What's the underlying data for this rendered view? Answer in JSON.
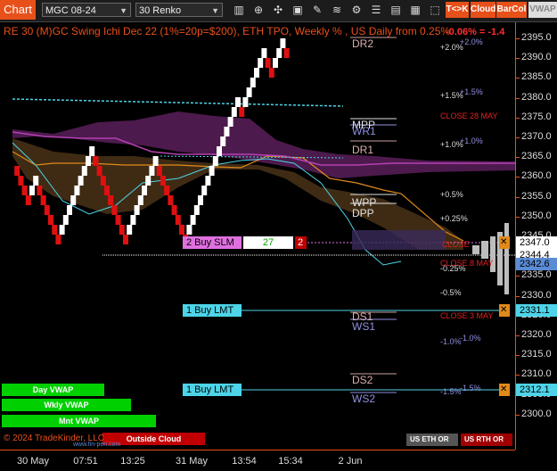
{
  "toolbar": {
    "chart_label": "Chart",
    "instrument": "MGC 08-24",
    "bar_type": "30 Renko",
    "tk_label": "T<>K",
    "cloud_label": "Cloud",
    "barcol_label": "BarCol",
    "vwap_label": "VWAP"
  },
  "header": {
    "title": "RE 30 (M)GC Swing Ichi Dec 22 (1%=20p=$200), ETH TPO, Weekly % , US Daily from 0.25%",
    "change": "-0.06% = -1.4"
  },
  "price_axis": {
    "labels": [
      "2395.0",
      "2390.0",
      "2385.0",
      "2380.0",
      "2375.0",
      "2370.0",
      "2365.0",
      "2360.0",
      "2355.0",
      "2350.0",
      "2345.0",
      "2340.0",
      "2335.0",
      "2330.0",
      "2325.0",
      "2320.0",
      "2315.0",
      "2310.0",
      "2305.0",
      "2300.0"
    ],
    "badges": [
      {
        "text": "2347.0",
        "bg": "#ffffff",
        "fg": "#000000"
      },
      {
        "text": "2344.4",
        "bg": "#ffffff",
        "fg": "#000000"
      },
      {
        "text": "2342.6",
        "bg": "#5a8cd6",
        "fg": "#000000"
      },
      {
        "text": "2331.1",
        "bg": "#4dd4e8",
        "fg": "#000000"
      },
      {
        "text": "2312.1",
        "bg": "#4dd4e8",
        "fg": "#000000"
      }
    ]
  },
  "time_axis": {
    "labels": [
      "30 May",
      "07:51",
      "13:25",
      "31 May",
      "13:54",
      "15:34",
      "2 Jun"
    ]
  },
  "levels": {
    "dr2": "DR2",
    "mpp": "MPP",
    "wr1": "WR1",
    "dr1": "DR1",
    "wpp": "WPP",
    "dpp": "DPP",
    "ds1": "DS1",
    "ws1": "WS1",
    "ds2": "DS2",
    "ws2": "WS2"
  },
  "pct_left": {
    "p20": "+2.0%",
    "p15": "+1.5%",
    "p10": "+1.0%",
    "p05": "+0.5%",
    "p025": "+0.25%",
    "m025": "-0.25%",
    "m05": "-0.5%",
    "m10": "-1.0%",
    "m15": "-1.5%"
  },
  "pct_right": {
    "p20": "+2.0%",
    "p15": "+1.5%",
    "p10": "+1.0%",
    "m10": "-1.0%",
    "m15": "-1.5%"
  },
  "closes": {
    "c28": "CLOSE 28 MAY",
    "c3": "CLOSE 3 MAY",
    "close_a": "CLOSE",
    "close_b": "CLOSE 8 MAY"
  },
  "orders": {
    "buy_slm": "2 Buy SLM",
    "slm_qty": "27",
    "slm_cnt": "2",
    "buy_lmt1": "1 Buy LMT",
    "buy_lmt2": "1 Buy LMT"
  },
  "vwap_bars": {
    "day": "Day VWAP",
    "wkly": "Wkly VWAP",
    "mnt": "Mnt VWAP",
    "outside": "Outside Cloud"
  },
  "footer": {
    "copyright": "© 2024 TradeKinder, LLC",
    "url": "www.fin-pen.com",
    "eth_btn": "US ETH OR",
    "rth_btn": "US RTH OR"
  },
  "colors": {
    "accent": "#e8501a",
    "cloud": "#6a2a6a",
    "orange_line": "#e08a1a",
    "cyan": "#4dd4e8",
    "down_brick": "#e01010",
    "up_brick": "#ffffff"
  }
}
